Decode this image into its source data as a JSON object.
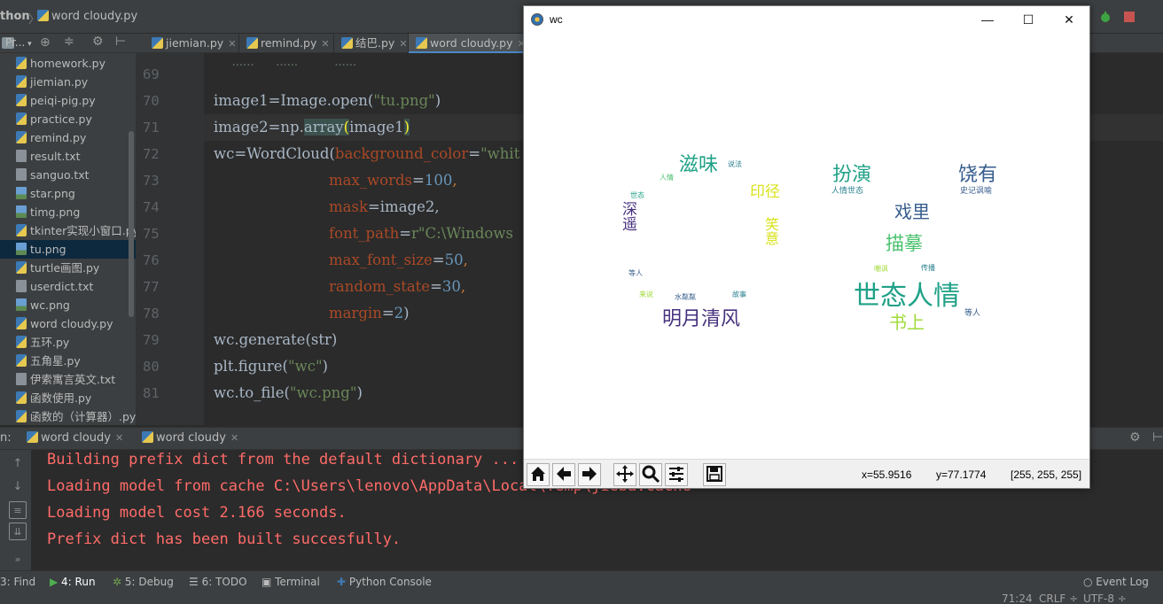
{
  "ide": {
    "breadcrumb": {
      "project": "thon",
      "file": "word cloudy.py"
    },
    "project_panel": {
      "title": "Pr..."
    },
    "project_files": [
      {
        "name": "homework.py",
        "type": "py"
      },
      {
        "name": "jiemian.py",
        "type": "py"
      },
      {
        "name": "peiqi-pig.py",
        "type": "py"
      },
      {
        "name": "practice.py",
        "type": "py"
      },
      {
        "name": "remind.py",
        "type": "py"
      },
      {
        "name": "result.txt",
        "type": "txt"
      },
      {
        "name": "sanguo.txt",
        "type": "txt"
      },
      {
        "name": "star.png",
        "type": "png"
      },
      {
        "name": "timg.png",
        "type": "png"
      },
      {
        "name": "tkinter实现小窗口.py",
        "type": "py"
      },
      {
        "name": "tu.png",
        "type": "png",
        "selected": true
      },
      {
        "name": "turtle画图.py",
        "type": "py"
      },
      {
        "name": "userdict.txt",
        "type": "txt"
      },
      {
        "name": "wc.png",
        "type": "png"
      },
      {
        "name": "word cloudy.py",
        "type": "py"
      },
      {
        "name": "五环.py",
        "type": "py"
      },
      {
        "name": "五角星.py",
        "type": "py"
      },
      {
        "name": "伊索寓言英文.txt",
        "type": "txt"
      },
      {
        "name": "函数使用.py",
        "type": "py"
      },
      {
        "name": "函数的（计算器）.py",
        "type": "py"
      }
    ],
    "editor_tabs": [
      {
        "label": "jiemian.py",
        "active": false
      },
      {
        "label": "remind.py",
        "active": false
      },
      {
        "label": "结巴.py",
        "active": false
      },
      {
        "label": "word cloudy.py",
        "active": true
      }
    ],
    "line_numbers": [
      "69",
      "70",
      "71",
      "72",
      "73",
      "74",
      "75",
      "76",
      "77",
      "78",
      "79",
      "80",
      "81"
    ],
    "code": {
      "l70_a": "image1",
      "l70_b": "=Image.open(",
      "l70_c": "\"tu.png\"",
      "l70_d": ")",
      "l71_a": "image2",
      "l71_b": "=np.",
      "l71_c": "array",
      "l71_d": "(",
      "l71_e": "image1",
      "l71_f": ")",
      "l72_a": "wc",
      "l72_b": "=WordCloud(",
      "l72_c": "background_color",
      "l72_d": "=",
      "l72_e": "\"whit",
      "l73_a": "max_words",
      "l73_b": "=",
      "l73_c": "100",
      "l73_d": ",",
      "l74_a": "mask",
      "l74_b": "=image2,",
      "l75_a": "font_path",
      "l75_b": "=",
      "l75_c": "r\"C:\\Windows",
      "l76_a": "max_font_size",
      "l76_b": "=",
      "l76_c": "50",
      "l76_d": ",",
      "l77_a": "random_state",
      "l77_b": "=",
      "l77_c": "30",
      "l77_d": ",",
      "l78_a": "margin",
      "l78_b": "=",
      "l78_c": "2",
      "l78_d": ")",
      "l79": "wc.generate(str)",
      "l80_a": "plt.figure(",
      "l80_b": "\"wc\"",
      "l80_c": ")",
      "l81_a": "wc.to_file(",
      "l81_b": "\"wc.png\"",
      "l81_c": ")"
    },
    "run_tabs": {
      "prefix": "n:",
      "tab1": "word cloudy",
      "tab2": "word cloudy"
    },
    "console_lines": [
      "Building prefix dict from the default dictionary ...",
      "Loading model from cache C:\\Users\\lenovo\\AppData\\Local\\Temp\\jieba.cache",
      "Loading model cost 2.166 seconds.",
      "Prefix dict has been built succesfully."
    ],
    "tool_tabs": {
      "find": "3: Find",
      "run": "4: Run",
      "debug": "5: Debug",
      "todo": "6: TODO",
      "terminal": "Terminal",
      "python_console": "Python Console",
      "event_log": "Event Log"
    },
    "status": {
      "position": "71:24",
      "line_sep": "CRLF ÷",
      "encoding": "UTF-8 ÷"
    }
  },
  "mpl_window": {
    "title": "wc",
    "readout": {
      "x": "x=55.9516",
      "y": "y=77.1774",
      "rgb": "[255, 255, 255]"
    },
    "toolbar_icons": [
      "home-icon",
      "back-icon",
      "forward-icon",
      "pan-icon",
      "zoom-icon",
      "configure-icon",
      "save-icon"
    ]
  },
  "word_cloud": {
    "large": [
      "世态人情",
      "明月清风",
      "书上",
      "滋味",
      "扮演",
      "饶有",
      "戏里",
      "描摹",
      "印径"
    ],
    "small": [
      "深遥",
      "水粼粼",
      "故事",
      "人情世态",
      "史记讽喻",
      "等人",
      "嘲讽",
      "说法",
      "传播",
      "笑意",
      "世态",
      "人情",
      "来说"
    ],
    "colors": {
      "purple": "#46327e",
      "blue": "#365c8d",
      "teal": "#277f8e",
      "green": "#1fa187",
      "lime": "#4ac16d",
      "yellow": "#a0da39",
      "gold": "#d8e219"
    }
  }
}
